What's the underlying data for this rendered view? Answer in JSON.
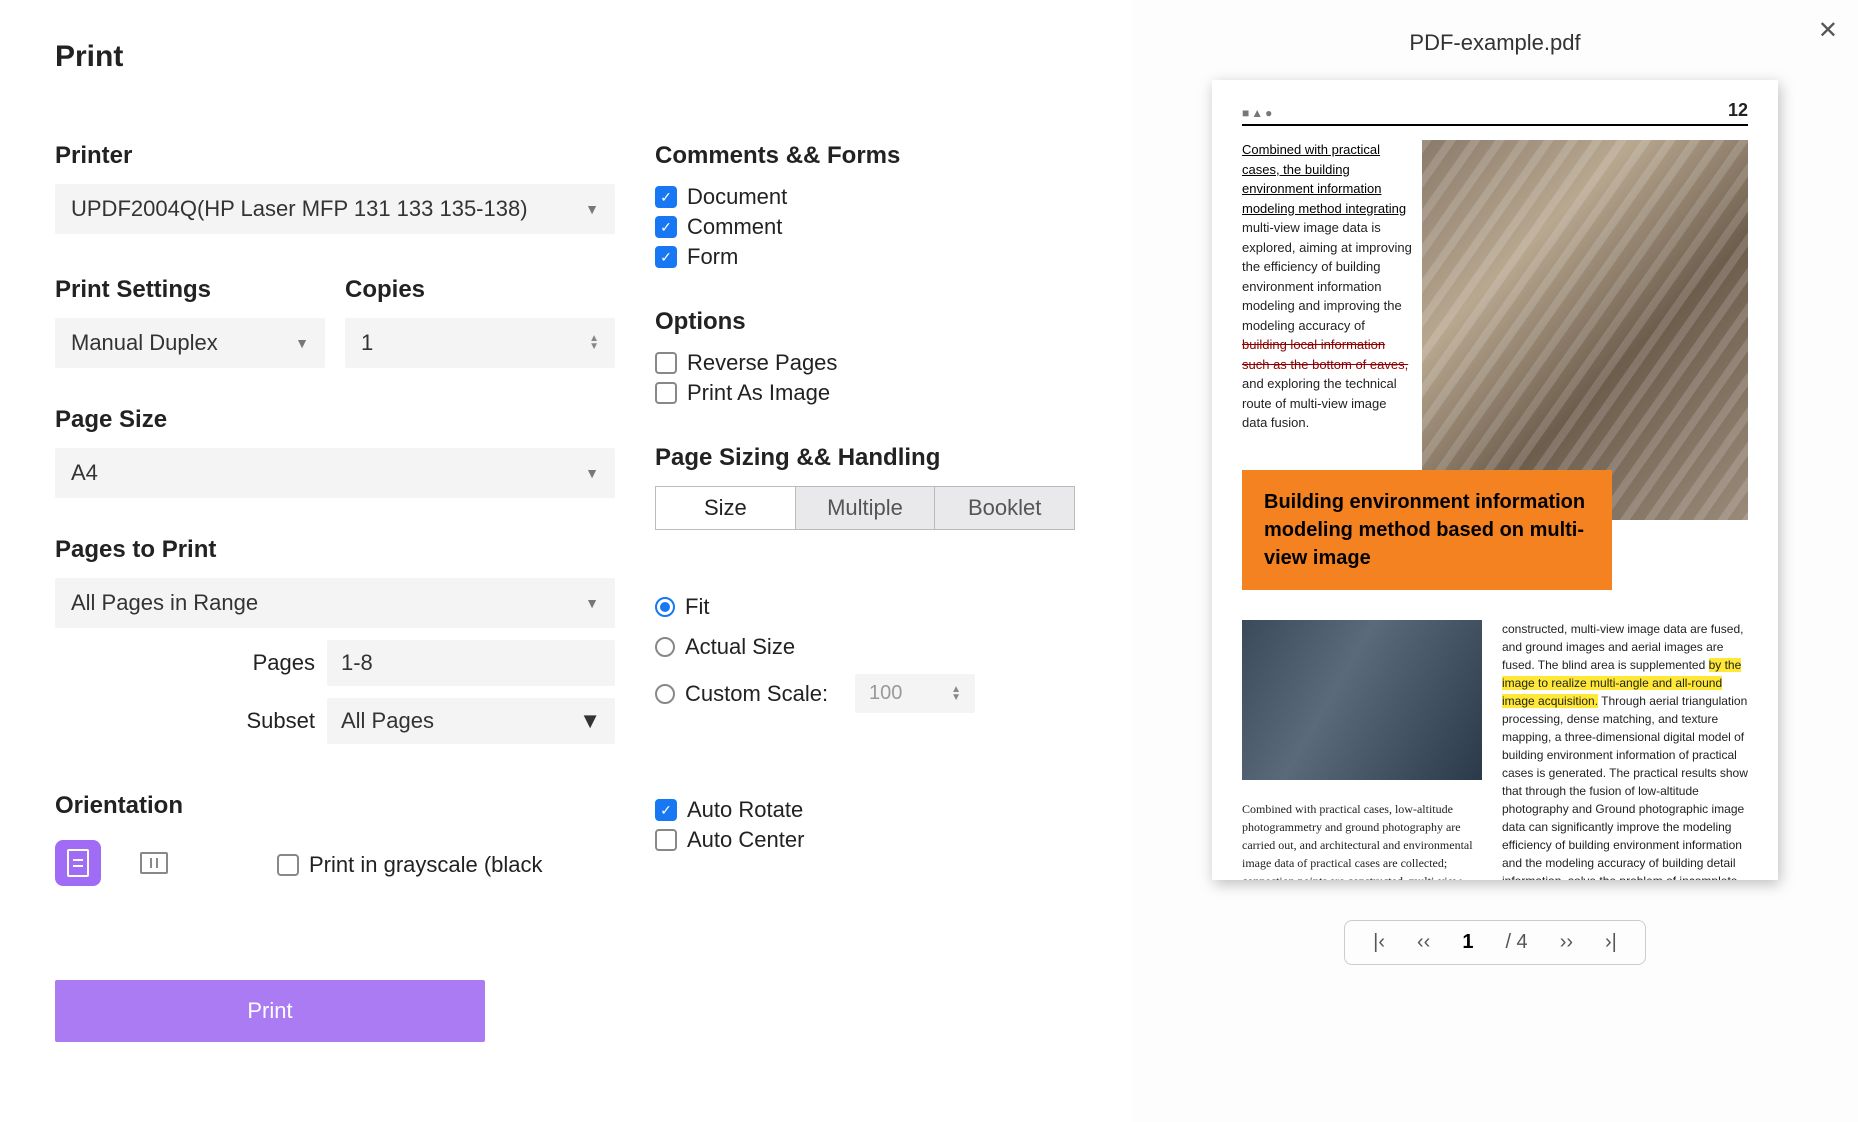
{
  "dialog": {
    "title": "Print",
    "printer_label": "Printer",
    "printer_value": "UPDF2004Q(HP Laser MFP 131 133 135-138)",
    "print_settings_label": "Print Settings",
    "print_settings_value": "Manual Duplex",
    "copies_label": "Copies",
    "copies_value": "1",
    "page_size_label": "Page Size",
    "page_size_value": "A4",
    "pages_to_print_label": "Pages to Print",
    "pages_to_print_value": "All Pages in Range",
    "pages_label": "Pages",
    "pages_value": "1-8",
    "subset_label": "Subset",
    "subset_value": "All Pages",
    "orientation_label": "Orientation",
    "grayscale_label": "Print in grayscale (black",
    "print_button": "Print",
    "comments_forms_label": "Comments && Forms",
    "cf_document": "Document",
    "cf_comment": "Comment",
    "cf_form": "Form",
    "options_label": "Options",
    "opt_reverse": "Reverse Pages",
    "opt_print_image": "Print As Image",
    "sizing_label": "Page Sizing && Handling",
    "tab_size": "Size",
    "tab_multiple": "Multiple",
    "tab_booklet": "Booklet",
    "radio_fit": "Fit",
    "radio_actual": "Actual Size",
    "radio_custom": "Custom Scale:",
    "custom_scale_value": "100",
    "auto_rotate": "Auto Rotate",
    "auto_center": "Auto Center"
  },
  "preview": {
    "filename": "PDF-example.pdf",
    "page_number": "12",
    "shapes": "■▲●",
    "text1_underlined": "Combined with practical cases, the building environment information modeling method integrating",
    "text1_plain": " multi-view image data is explored, aiming at improving the efficiency of building environment information modeling and improving the modeling accuracy of ",
    "text1_strike": "building local information such as the bottom of eaves,",
    "text1_tail": " and exploring the technical route of multi-view image data fusion.",
    "orange_title": "Building environment information modeling method based on multi-view image",
    "text2_pre": "constructed, multi-view image data are fused, and ground images and aerial images are fused. The blind area is supplemented ",
    "text2_hl": "by the image to realize multi-angle and all-round image acquisition.",
    "text2_post": " Through aerial triangulation processing, dense matching, and texture mapping, a three-dimensional digital model of building environment information of practical cases is generated. The practical results show that through the fusion of low-altitude photography and Ground photographic image data can significantly improve the modeling efficiency of building environment information and the modeling accuracy of building detail information, solve the problem of incomplete information",
    "text3": "Combined with practical cases, low-altitude photogrammetry and ground photography are carried out, and architectural and environmental image data of practical cases are collected; connection points are constructed, multi-view image data are",
    "pager_current": "1",
    "pager_total": "/ 4"
  }
}
